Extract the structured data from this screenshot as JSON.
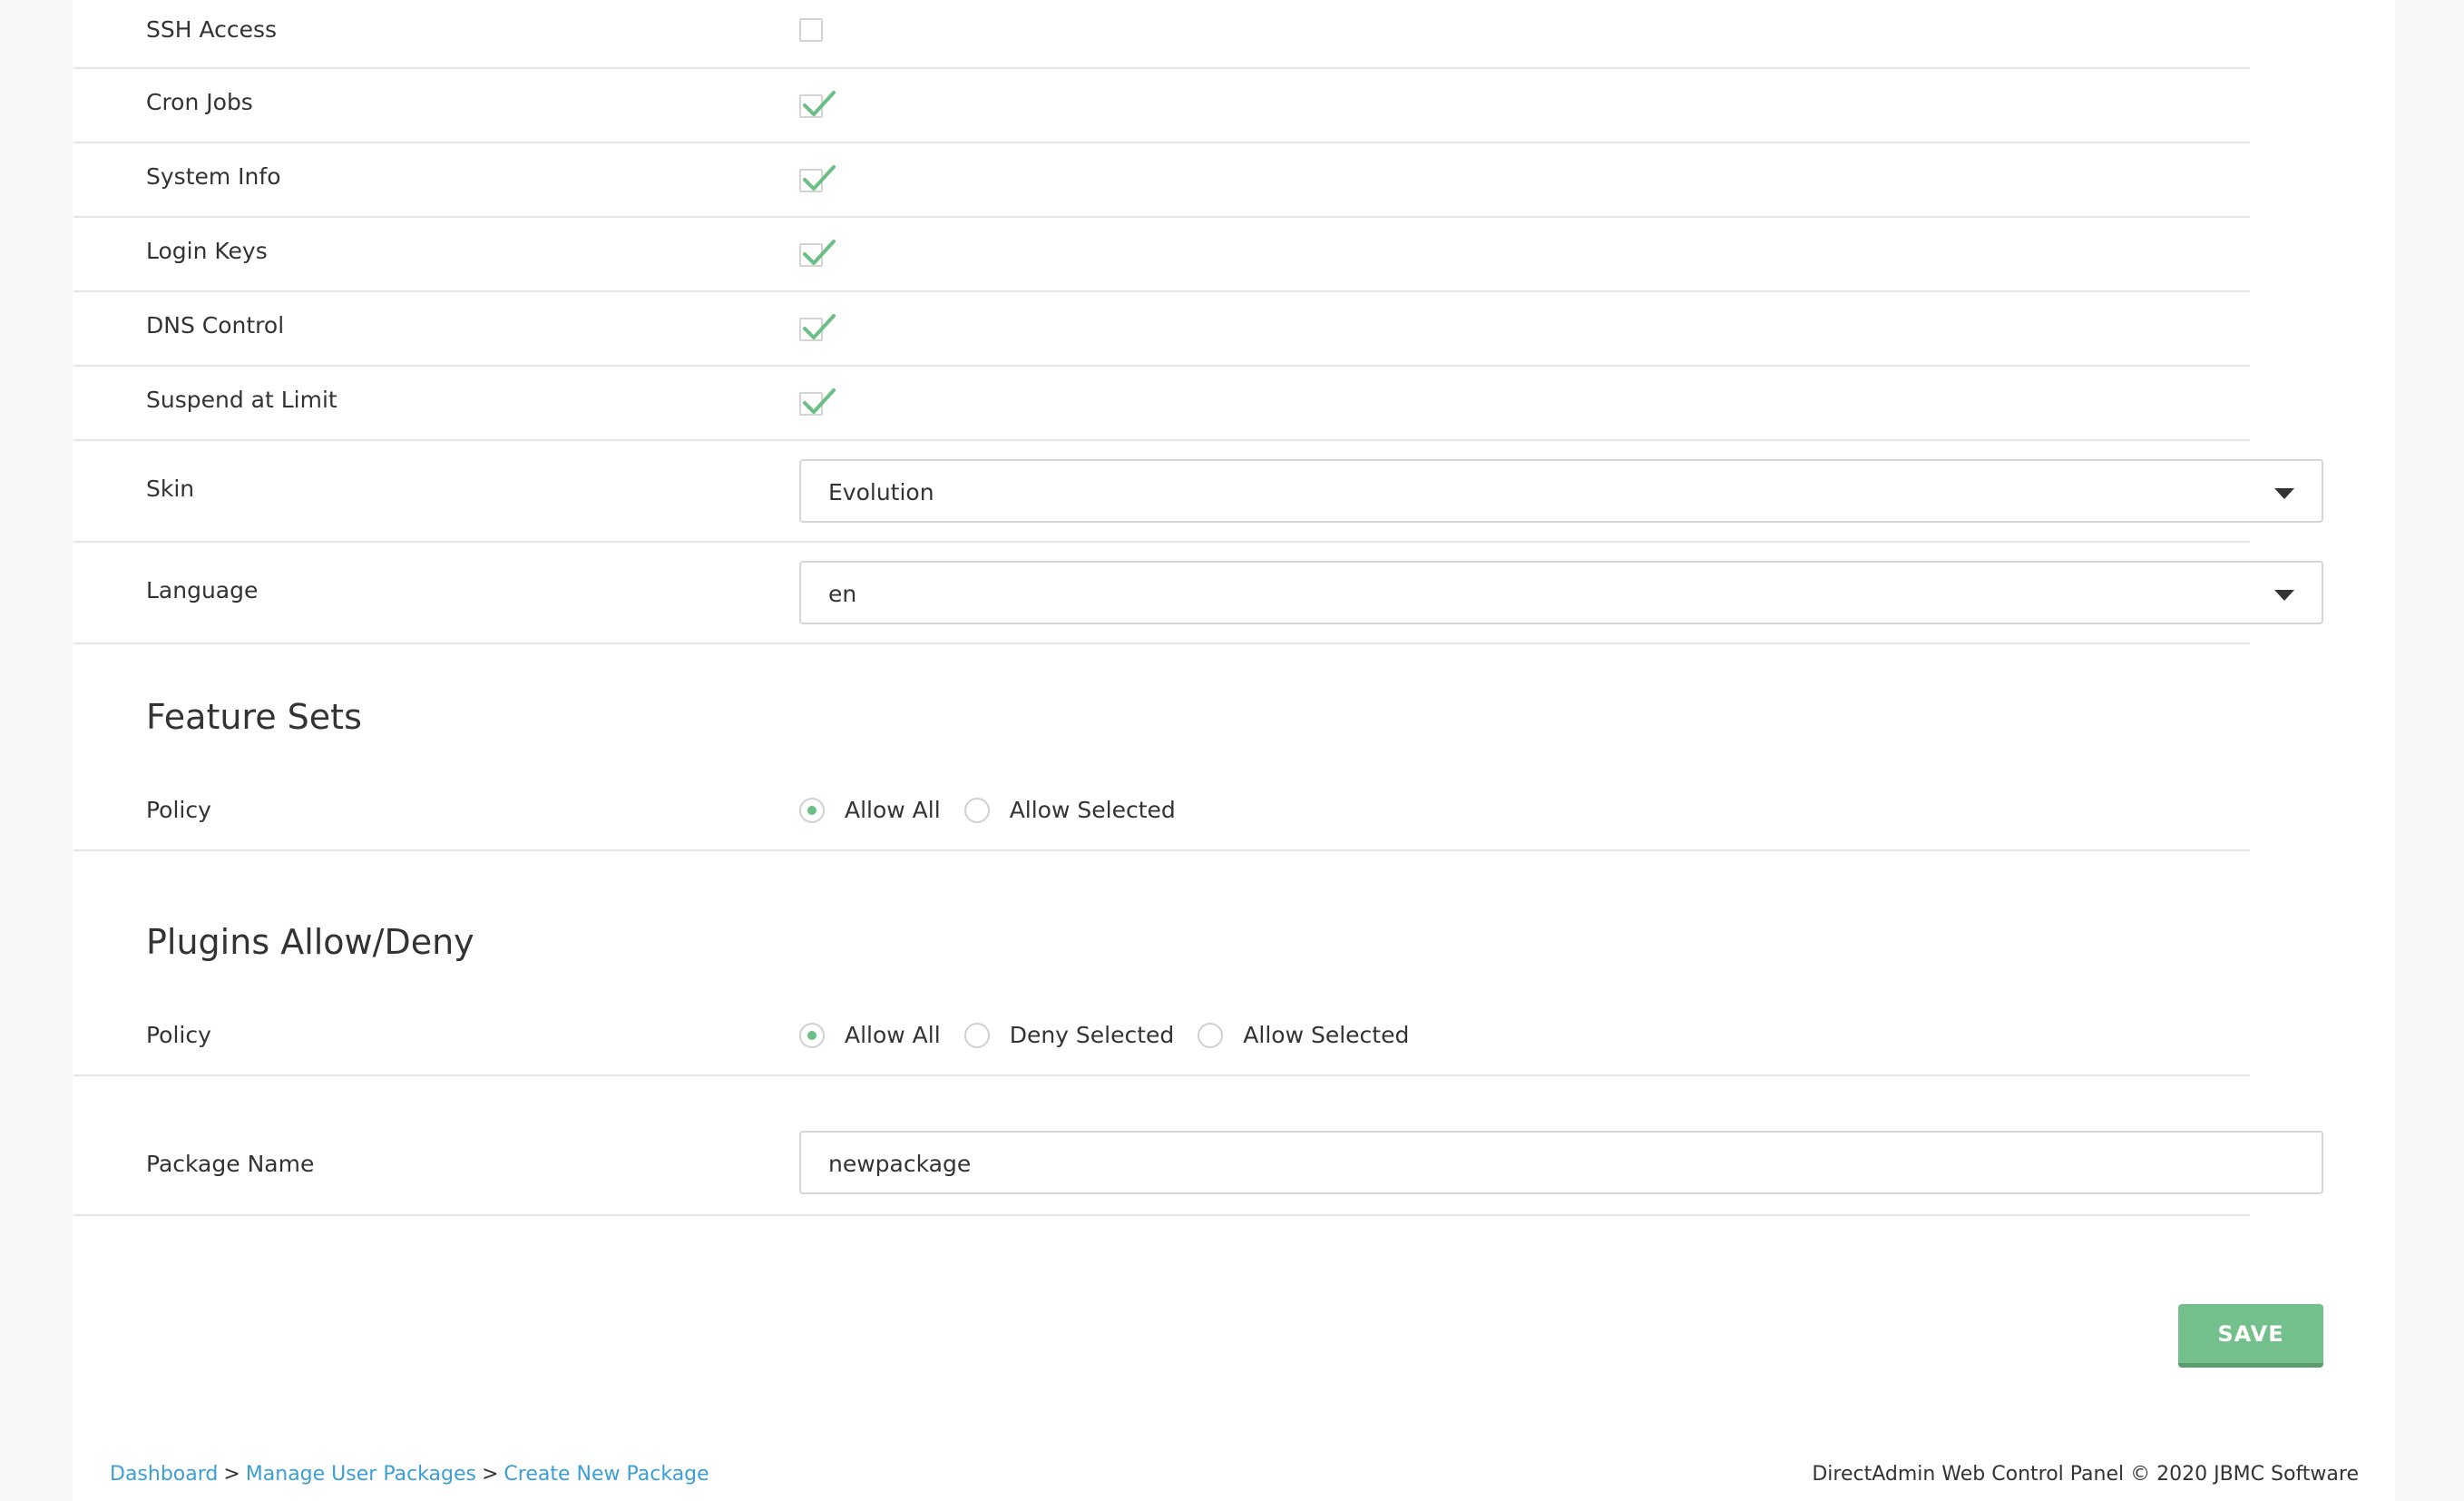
{
  "rows": {
    "ssh_access": {
      "label": "SSH Access",
      "checked": false
    },
    "cron_jobs": {
      "label": "Cron Jobs",
      "checked": true
    },
    "system_info": {
      "label": "System Info",
      "checked": true
    },
    "login_keys": {
      "label": "Login Keys",
      "checked": true
    },
    "dns_control": {
      "label": "DNS Control",
      "checked": true
    },
    "suspend_at_limit": {
      "label": "Suspend at Limit",
      "checked": true
    }
  },
  "skin": {
    "label": "Skin",
    "value": "Evolution"
  },
  "language": {
    "label": "Language",
    "value": "en"
  },
  "feature_sets": {
    "title": "Feature Sets",
    "policy_label": "Policy",
    "options": [
      "Allow All",
      "Allow Selected"
    ],
    "selected": "Allow All"
  },
  "plugins": {
    "title": "Plugins Allow/Deny",
    "policy_label": "Policy",
    "options": [
      "Allow All",
      "Deny Selected",
      "Allow Selected"
    ],
    "selected": "Allow All"
  },
  "package_name": {
    "label": "Package Name",
    "value": "newpackage"
  },
  "save_label": "SAVE",
  "breadcrumb": {
    "items": [
      "Dashboard",
      "Manage User Packages",
      "Create New Package"
    ],
    "separator": ">"
  },
  "copyright": "DirectAdmin Web Control Panel © 2020 JBMC Software",
  "colors": {
    "accent_green": "#74c08c",
    "link_blue": "#3c9fd4",
    "check_green": "#6cbf84"
  },
  "icons": {
    "checkmark": "checkmark-icon",
    "dropdown": "chevron-down-icon"
  }
}
